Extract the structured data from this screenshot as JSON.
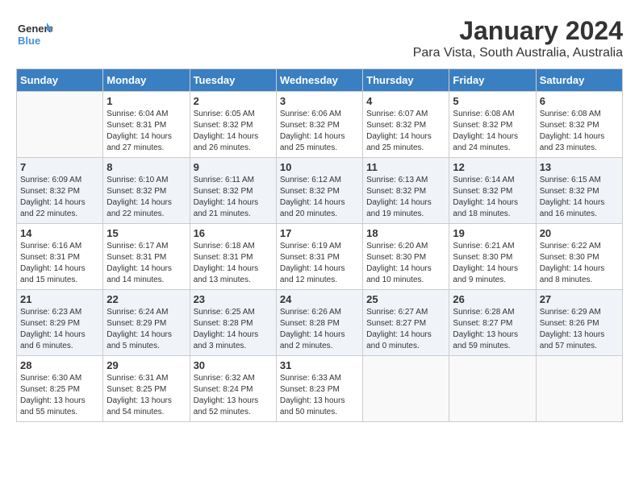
{
  "header": {
    "logo_general": "General",
    "logo_blue": "Blue",
    "title": "January 2024",
    "subtitle": "Para Vista, South Australia, Australia"
  },
  "calendar": {
    "days_of_week": [
      "Sunday",
      "Monday",
      "Tuesday",
      "Wednesday",
      "Thursday",
      "Friday",
      "Saturday"
    ],
    "weeks": [
      [
        {
          "day": "",
          "info": ""
        },
        {
          "day": "1",
          "info": "Sunrise: 6:04 AM\nSunset: 8:31 PM\nDaylight: 14 hours\nand 27 minutes."
        },
        {
          "day": "2",
          "info": "Sunrise: 6:05 AM\nSunset: 8:32 PM\nDaylight: 14 hours\nand 26 minutes."
        },
        {
          "day": "3",
          "info": "Sunrise: 6:06 AM\nSunset: 8:32 PM\nDaylight: 14 hours\nand 25 minutes."
        },
        {
          "day": "4",
          "info": "Sunrise: 6:07 AM\nSunset: 8:32 PM\nDaylight: 14 hours\nand 25 minutes."
        },
        {
          "day": "5",
          "info": "Sunrise: 6:08 AM\nSunset: 8:32 PM\nDaylight: 14 hours\nand 24 minutes."
        },
        {
          "day": "6",
          "info": "Sunrise: 6:08 AM\nSunset: 8:32 PM\nDaylight: 14 hours\nand 23 minutes."
        }
      ],
      [
        {
          "day": "7",
          "info": "Sunrise: 6:09 AM\nSunset: 8:32 PM\nDaylight: 14 hours\nand 22 minutes."
        },
        {
          "day": "8",
          "info": "Sunrise: 6:10 AM\nSunset: 8:32 PM\nDaylight: 14 hours\nand 22 minutes."
        },
        {
          "day": "9",
          "info": "Sunrise: 6:11 AM\nSunset: 8:32 PM\nDaylight: 14 hours\nand 21 minutes."
        },
        {
          "day": "10",
          "info": "Sunrise: 6:12 AM\nSunset: 8:32 PM\nDaylight: 14 hours\nand 20 minutes."
        },
        {
          "day": "11",
          "info": "Sunrise: 6:13 AM\nSunset: 8:32 PM\nDaylight: 14 hours\nand 19 minutes."
        },
        {
          "day": "12",
          "info": "Sunrise: 6:14 AM\nSunset: 8:32 PM\nDaylight: 14 hours\nand 18 minutes."
        },
        {
          "day": "13",
          "info": "Sunrise: 6:15 AM\nSunset: 8:32 PM\nDaylight: 14 hours\nand 16 minutes."
        }
      ],
      [
        {
          "day": "14",
          "info": "Sunrise: 6:16 AM\nSunset: 8:31 PM\nDaylight: 14 hours\nand 15 minutes."
        },
        {
          "day": "15",
          "info": "Sunrise: 6:17 AM\nSunset: 8:31 PM\nDaylight: 14 hours\nand 14 minutes."
        },
        {
          "day": "16",
          "info": "Sunrise: 6:18 AM\nSunset: 8:31 PM\nDaylight: 14 hours\nand 13 minutes."
        },
        {
          "day": "17",
          "info": "Sunrise: 6:19 AM\nSunset: 8:31 PM\nDaylight: 14 hours\nand 12 minutes."
        },
        {
          "day": "18",
          "info": "Sunrise: 6:20 AM\nSunset: 8:30 PM\nDaylight: 14 hours\nand 10 minutes."
        },
        {
          "day": "19",
          "info": "Sunrise: 6:21 AM\nSunset: 8:30 PM\nDaylight: 14 hours\nand 9 minutes."
        },
        {
          "day": "20",
          "info": "Sunrise: 6:22 AM\nSunset: 8:30 PM\nDaylight: 14 hours\nand 8 minutes."
        }
      ],
      [
        {
          "day": "21",
          "info": "Sunrise: 6:23 AM\nSunset: 8:29 PM\nDaylight: 14 hours\nand 6 minutes."
        },
        {
          "day": "22",
          "info": "Sunrise: 6:24 AM\nSunset: 8:29 PM\nDaylight: 14 hours\nand 5 minutes."
        },
        {
          "day": "23",
          "info": "Sunrise: 6:25 AM\nSunset: 8:28 PM\nDaylight: 14 hours\nand 3 minutes."
        },
        {
          "day": "24",
          "info": "Sunrise: 6:26 AM\nSunset: 8:28 PM\nDaylight: 14 hours\nand 2 minutes."
        },
        {
          "day": "25",
          "info": "Sunrise: 6:27 AM\nSunset: 8:27 PM\nDaylight: 14 hours\nand 0 minutes."
        },
        {
          "day": "26",
          "info": "Sunrise: 6:28 AM\nSunset: 8:27 PM\nDaylight: 13 hours\nand 59 minutes."
        },
        {
          "day": "27",
          "info": "Sunrise: 6:29 AM\nSunset: 8:26 PM\nDaylight: 13 hours\nand 57 minutes."
        }
      ],
      [
        {
          "day": "28",
          "info": "Sunrise: 6:30 AM\nSunset: 8:25 PM\nDaylight: 13 hours\nand 55 minutes."
        },
        {
          "day": "29",
          "info": "Sunrise: 6:31 AM\nSunset: 8:25 PM\nDaylight: 13 hours\nand 54 minutes."
        },
        {
          "day": "30",
          "info": "Sunrise: 6:32 AM\nSunset: 8:24 PM\nDaylight: 13 hours\nand 52 minutes."
        },
        {
          "day": "31",
          "info": "Sunrise: 6:33 AM\nSunset: 8:23 PM\nDaylight: 13 hours\nand 50 minutes."
        },
        {
          "day": "",
          "info": ""
        },
        {
          "day": "",
          "info": ""
        },
        {
          "day": "",
          "info": ""
        }
      ]
    ]
  }
}
